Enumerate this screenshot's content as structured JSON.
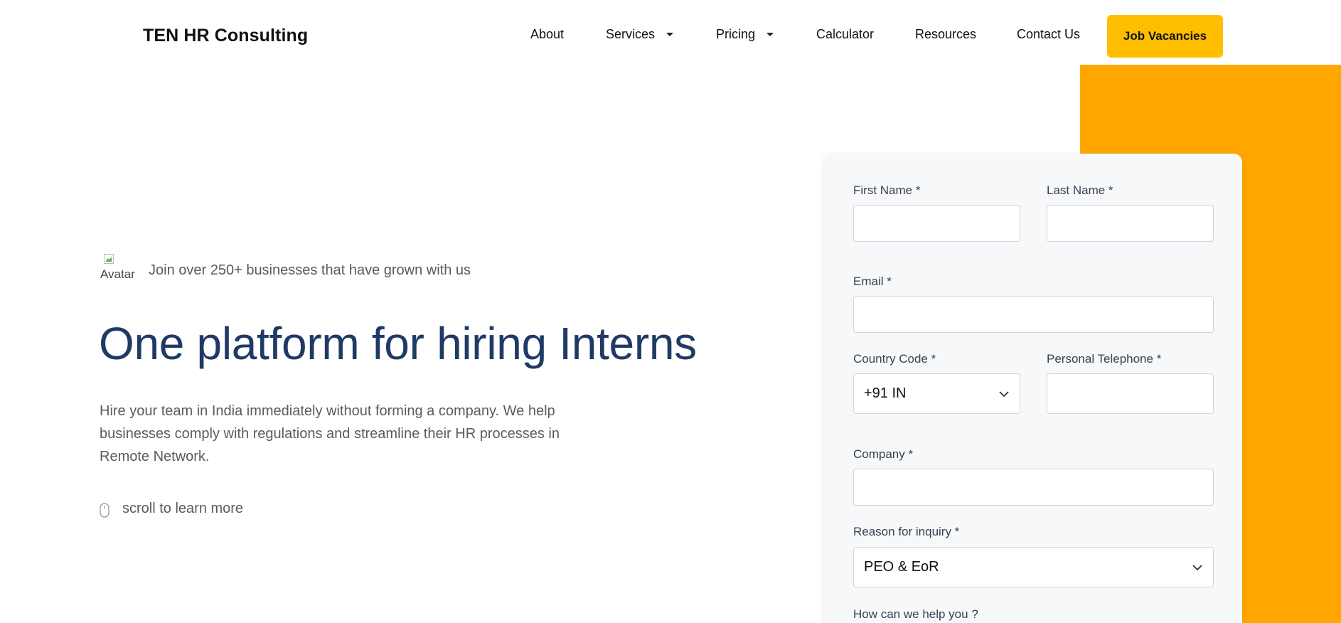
{
  "header": {
    "brand": "TEN HR Consulting",
    "nav": [
      {
        "label": "About",
        "has_dropdown": false
      },
      {
        "label": "Services",
        "has_dropdown": true
      },
      {
        "label": "Pricing",
        "has_dropdown": true
      },
      {
        "label": "Calculator",
        "has_dropdown": false
      },
      {
        "label": "Resources",
        "has_dropdown": false
      },
      {
        "label": "Contact Us",
        "has_dropdown": false
      }
    ],
    "cta_label": "Job Vacancies"
  },
  "hero": {
    "avatar_alt": "Avatar",
    "social_proof": "Join over 250+ businesses that have grown with us",
    "headline": "One platform for hiring Interns",
    "subtext": "Hire your team in India immediately without forming a company. We help businesses comply with regulations and streamline their HR processes in Remote Network.",
    "scroll_hint": "scroll to learn more"
  },
  "form": {
    "first_name_label": "First Name *",
    "first_name_value": "",
    "last_name_label": "Last Name *",
    "last_name_value": "",
    "email_label": "Email *",
    "email_value": "",
    "country_code_label": "Country Code *",
    "country_code_value": "+91 IN",
    "phone_label": "Personal Telephone *",
    "phone_value": "",
    "company_label": "Company *",
    "company_value": "",
    "reason_label": "Reason for inquiry *",
    "reason_value": "PEO & EoR",
    "help_label": "How can we help you ?"
  },
  "colors": {
    "accent_yellow": "#ffbf00",
    "accent_orange": "#ffa600",
    "headline_navy": "#1f3a64"
  },
  "icons": {
    "dropdown": "caret-down-icon",
    "select": "chevron-down-icon",
    "scroll": "mouse-icon"
  }
}
